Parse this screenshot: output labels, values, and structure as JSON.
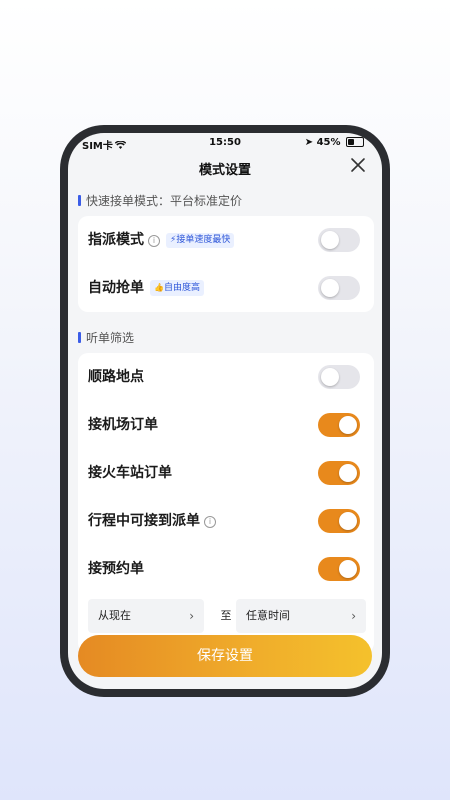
{
  "status_bar": {
    "carrier": "SIM卡",
    "time": "15:50",
    "battery": "45%"
  },
  "header": {
    "title": "模式设置"
  },
  "section_fast": {
    "title": "快速接单模式：平台标准定价",
    "rows": [
      {
        "label": "指派模式",
        "badge": "接单速度最快",
        "on": false
      },
      {
        "label": "自动抢单",
        "badge": "自由度高",
        "on": false
      }
    ]
  },
  "section_filter": {
    "title": "听单筛选",
    "rows": [
      {
        "label": "顺路地点",
        "on": false
      },
      {
        "label": "接机场订单",
        "on": true
      },
      {
        "label": "接火车站订单",
        "on": true
      },
      {
        "label": "行程中可接到派单",
        "on": true
      },
      {
        "label": "接预约单",
        "on": true
      }
    ],
    "time_range": {
      "from": "从现在",
      "separator": "至",
      "to": "任意时间"
    }
  },
  "save_button": {
    "label": "保存设置"
  },
  "icons": {
    "info": "i",
    "chevron": "›",
    "bolt": "⚡",
    "thumb": "👍"
  },
  "colors": {
    "accent": "#e8891c",
    "badge_text": "#2f57d9",
    "badge_bg": "#eaf0ff"
  }
}
